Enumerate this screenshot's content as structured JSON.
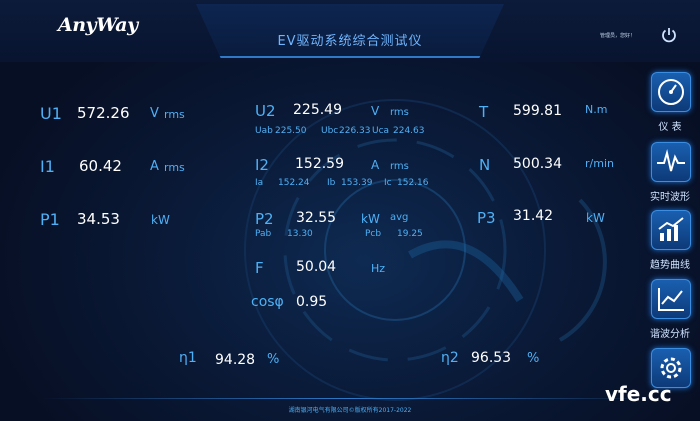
{
  "header": {
    "logo": "AnyWay",
    "title": "EV驱动系统综合测试仪",
    "greeting": "管理员，您好！"
  },
  "readings": {
    "U1": {
      "label": "U1",
      "value": "572.26",
      "unit_main": "V",
      "unit_sub": "rms"
    },
    "I1": {
      "label": "I1",
      "value": "60.42",
      "unit_main": "A",
      "unit_sub": "rms"
    },
    "P1": {
      "label": "P1",
      "value": "34.53",
      "unit": "kW"
    },
    "U2": {
      "label": "U2",
      "value": "225.49",
      "unit_main": "V",
      "unit_sub": "rms",
      "sub": [
        {
          "label": "Uab",
          "value": "225.50"
        },
        {
          "label": "Ubc",
          "value": "226.33"
        },
        {
          "label": "Uca",
          "value": "224.63"
        }
      ]
    },
    "I2": {
      "label": "I2",
      "value": "152.59",
      "unit_main": "A",
      "unit_sub": "rms",
      "sub": [
        {
          "label": "Ia",
          "value": "152.24"
        },
        {
          "label": "Ib",
          "value": "153.39"
        },
        {
          "label": "Ic",
          "value": "152.16"
        }
      ]
    },
    "P2": {
      "label": "P2",
      "value": "32.55",
      "unit": "kW",
      "unit_sub": "avg",
      "sub": [
        {
          "label": "Pab",
          "value": "13.30"
        },
        {
          "label": "Pcb",
          "value": "19.25"
        }
      ]
    },
    "F": {
      "label": "F",
      "value": "50.04",
      "unit": "Hz"
    },
    "cos": {
      "label": "cosφ",
      "value": "0.95"
    },
    "T": {
      "label": "T",
      "value": "599.81",
      "unit": "N.m"
    },
    "N": {
      "label": "N",
      "value": "500.34",
      "unit": "r/min"
    },
    "P3": {
      "label": "P3",
      "value": "31.42",
      "unit": "kW"
    },
    "eta1": {
      "label": "η1",
      "value": "94.28",
      "unit": "%"
    },
    "eta2": {
      "label": "η2",
      "value": "96.53",
      "unit": "%"
    }
  },
  "sidebar": {
    "items": [
      {
        "label": "仪 表",
        "icon": "gauge-icon"
      },
      {
        "label": "实时波形",
        "icon": "waveform-icon"
      },
      {
        "label": "趋势曲线",
        "icon": "trend-chart-icon"
      },
      {
        "label": "谐波分析",
        "icon": "harmonic-chart-icon"
      },
      {
        "label": "",
        "icon": "gear-icon"
      }
    ]
  },
  "footer": "湖南银河电气有限公司©版权所有2017-2022",
  "watermark": "vfe.cc",
  "colors": {
    "accent": "#4fb0f5",
    "background": "#0a1a38",
    "icon_fill": "#1a5fb0"
  }
}
